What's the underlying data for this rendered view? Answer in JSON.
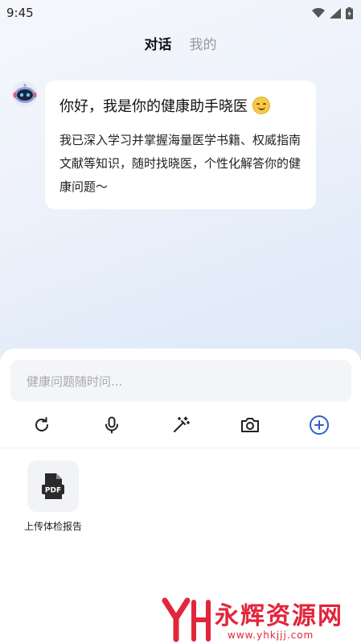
{
  "status_bar": {
    "time": "9:45"
  },
  "tabs": [
    {
      "label": "对话",
      "active": true
    },
    {
      "label": "我的",
      "active": false
    }
  ],
  "chat": {
    "greeting": "你好，我是你的健康助手晓医",
    "greeting_emoji": "smiling-face-icon",
    "body": "我已深入学习并掌握海量医学书籍、权威指南文献等知识，随时找晓医，个性化解答你的健康问题～"
  },
  "input": {
    "placeholder": "健康问题随时问..."
  },
  "toolbar": {
    "icons": [
      "refresh-icon",
      "microphone-icon",
      "magic-wand-icon",
      "camera-icon",
      "plus-circle-icon"
    ]
  },
  "upload": {
    "icon_text": "PDF",
    "label": "上传体检报告"
  },
  "watermark": {
    "brand": "永辉资源网",
    "url": "www.yhkjjj.com"
  },
  "colors": {
    "accent_blue": "#2f5fd0",
    "watermark_red": "#e1263a"
  }
}
